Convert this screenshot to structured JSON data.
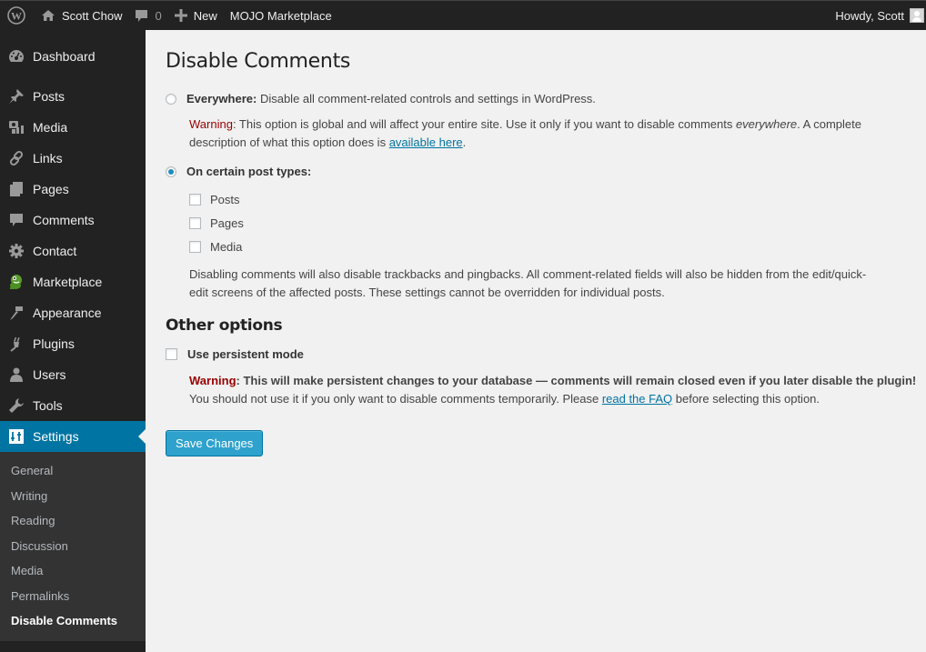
{
  "adminbar": {
    "site_name": "Scott Chow",
    "comment_count": "0",
    "new_label": "New",
    "marketplace_label": "MOJO Marketplace",
    "howdy": "Howdy, Scott"
  },
  "sidebar": {
    "items": [
      {
        "label": "Dashboard",
        "icon": "dashboard-icon"
      },
      {
        "label": "Posts",
        "icon": "pin-icon"
      },
      {
        "label": "Media",
        "icon": "media-icon"
      },
      {
        "label": "Links",
        "icon": "link-icon"
      },
      {
        "label": "Pages",
        "icon": "pages-icon"
      },
      {
        "label": "Comments",
        "icon": "comment-icon"
      },
      {
        "label": "Contact",
        "icon": "gear-icon"
      },
      {
        "label": "Marketplace",
        "icon": "mojo-mascot-icon"
      },
      {
        "label": "Appearance",
        "icon": "brush-icon"
      },
      {
        "label": "Plugins",
        "icon": "plug-icon"
      },
      {
        "label": "Users",
        "icon": "user-icon"
      },
      {
        "label": "Tools",
        "icon": "wrench-icon"
      },
      {
        "label": "Settings",
        "icon": "settings-icon",
        "active": true
      }
    ],
    "submenu": [
      {
        "label": "General"
      },
      {
        "label": "Writing"
      },
      {
        "label": "Reading"
      },
      {
        "label": "Discussion"
      },
      {
        "label": "Media"
      },
      {
        "label": "Permalinks"
      },
      {
        "label": "Disable Comments",
        "current": true
      }
    ]
  },
  "main": {
    "title": "Disable Comments",
    "everywhere": {
      "label_bold": "Everywhere:",
      "label_rest": " Disable all comment-related controls and settings in WordPress.",
      "checked": false,
      "warning_label": "Warning",
      "warning_text_1": ": This option is global and will affect your entire site. Use it only if you want to disable comments ",
      "warning_em": "everywhere",
      "warning_text_2": ". A complete description of what this option does is ",
      "warning_link": "available here",
      "warning_end": "."
    },
    "certain": {
      "label": "On certain post types:",
      "checked": true,
      "post_types": [
        {
          "label": "Posts",
          "checked": false
        },
        {
          "label": "Pages",
          "checked": false
        },
        {
          "label": "Media",
          "checked": false
        }
      ],
      "note": "Disabling comments will also disable trackbacks and pingbacks. All comment-related fields will also be hidden from the edit/quick-edit screens of the affected posts. These settings cannot be overridden for individual posts."
    },
    "other": {
      "heading": "Other options",
      "persistent_label": "Use persistent mode",
      "persistent_checked": false,
      "warning_label": "Warning",
      "warning_bold": ": This will make persistent changes to your database — comments will remain closed even if you later disable the plugin!",
      "warning_text": " You should not use it if you only want to disable comments temporarily. Please ",
      "warning_link": "read the FAQ",
      "warning_end": " before selecting this option."
    },
    "save_label": "Save Changes"
  },
  "colors": {
    "accent": "#0074a2",
    "button": "#2ea2cc",
    "warning": "#990000",
    "sidebar_bg": "#222222"
  }
}
